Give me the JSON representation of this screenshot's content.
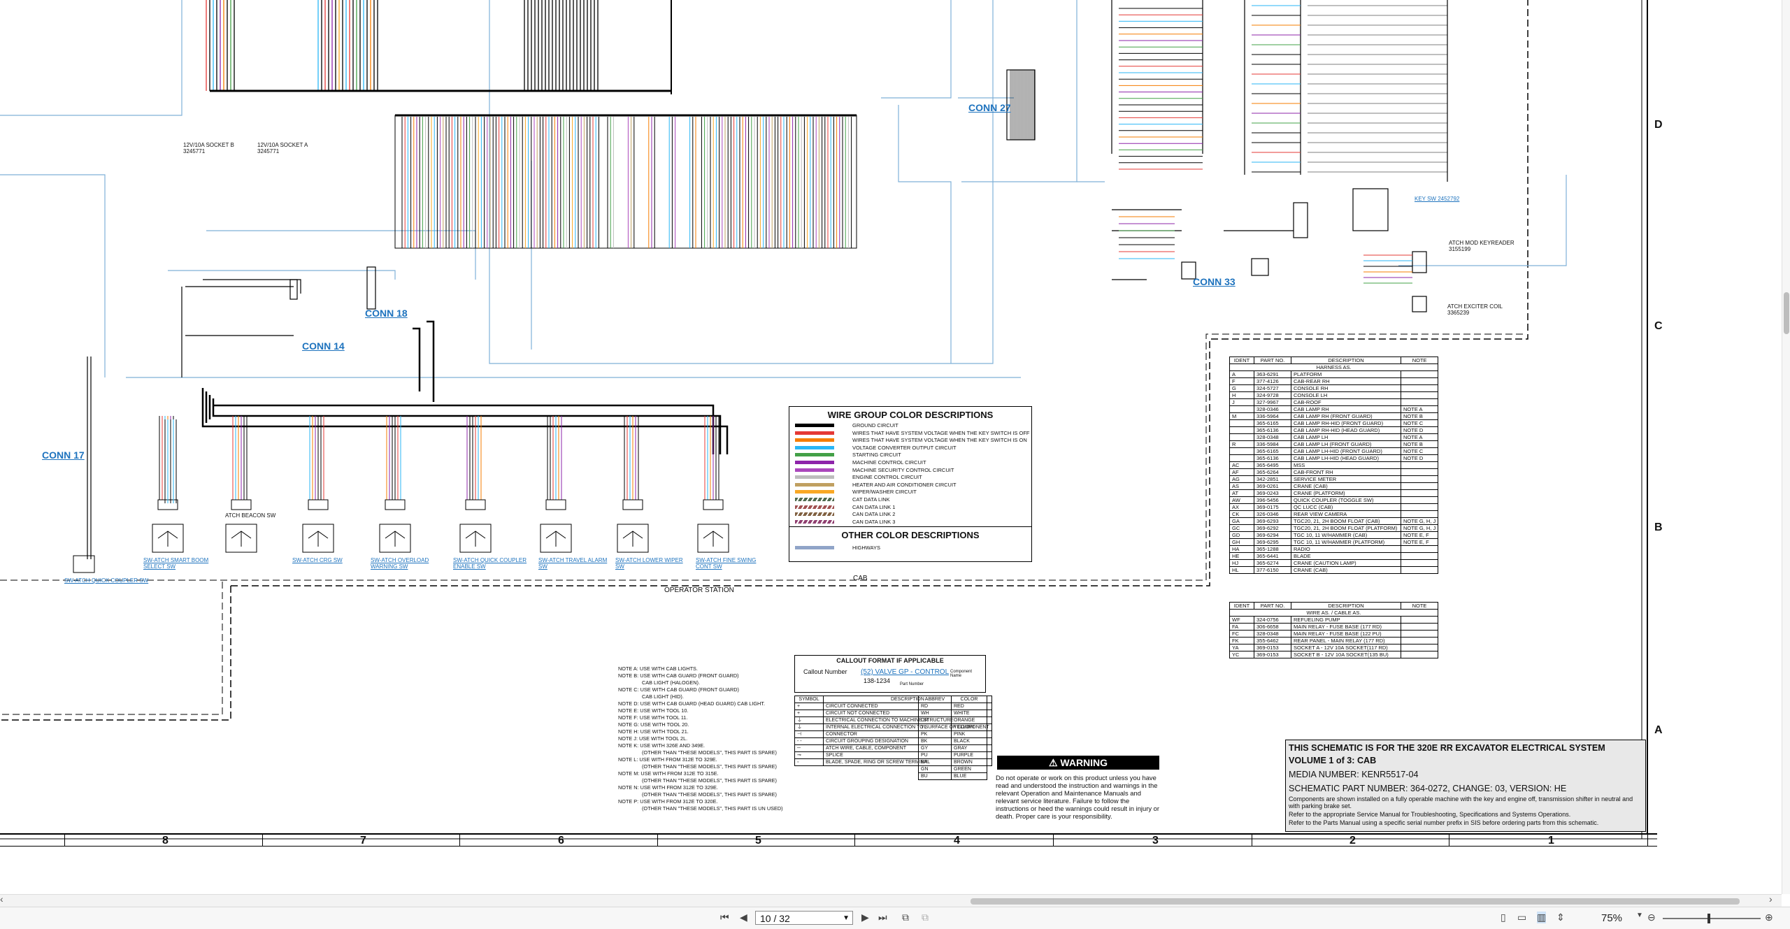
{
  "schematic": {
    "connectors": {
      "conn27": "CONN 27",
      "conn18": "CONN 18",
      "conn14": "CONN 14",
      "conn17": "CONN 17",
      "conn33": "CONN 33"
    },
    "labels": {
      "cab": "CAB",
      "operator_station": "OPERATOR STATION",
      "socket_b": "12V/10A SOCKET B\n3245771",
      "socket_a": "12V/10A SOCKET A\n3245771",
      "atch_beacon": "ATCH BEACON SW",
      "quick_coupler": "SW-ATCH QUICK COUPLER SW",
      "atch_mod": "ATCH MOD KEYREADER\n3155199",
      "atch_exciter": "ATCH EXCITER COIL\n3365239",
      "key_sw": "KEY SW\n2452792"
    },
    "switches": [
      "SW-ATCH SMART BOOM SELECT SW",
      "SW-ATCH CRG SW",
      "SW-ATCH OVERLOAD WARNING SW",
      "SW-ATCH QUICK COUPLER ENABLE SW",
      "SW-ATCH TRAVEL ALARM SW",
      "SW-ATCH LOWER WIPER SW",
      "SW-ATCH FINE SWING CONT SW"
    ]
  },
  "wire_colors": {
    "title": "WIRE GROUP COLOR DESCRIPTIONS",
    "items": [
      {
        "color": "#000000",
        "desc": "GROUND CIRCUIT"
      },
      {
        "color": "#e53935",
        "desc": "WIRES THAT HAVE SYSTEM VOLTAGE WHEN THE KEY SWITCH IS OFF"
      },
      {
        "color": "#f57c00",
        "desc": "WIRES THAT HAVE SYSTEM VOLTAGE WHEN THE KEY SWITCH IS ON"
      },
      {
        "color": "#29b6f6",
        "desc": "VOLTAGE CONVERTER OUTPUT CIRCUIT"
      },
      {
        "color": "#43a047",
        "desc": "STARTING CIRCUIT"
      },
      {
        "color": "#8e24aa",
        "desc": "MACHINE CONTROL CIRCUIT"
      },
      {
        "color": "#ab47bc",
        "desc": "MACHINE SECURITY CONTROL CIRCUIT"
      },
      {
        "color": "#bdbdbd",
        "desc": "ENGINE CONTROL CIRCUIT"
      },
      {
        "color": "#c0a060",
        "desc": "HEATER AND AIR CONDITIONER CIRCUIT"
      },
      {
        "color": "#f9a825",
        "desc": "WIPER/WASHER CIRCUIT"
      },
      {
        "color": "#4e6a4e",
        "desc": "CAT DATA LINK"
      },
      {
        "color": "#a05050",
        "desc": "CAN DATA LINK 1"
      },
      {
        "color": "#806040",
        "desc": "CAN DATA LINK 2"
      },
      {
        "color": "#904070",
        "desc": "CAN DATA LINK 3"
      }
    ],
    "other_title": "OTHER COLOR DESCRIPTIONS",
    "other_items": [
      {
        "color": "#90a4c8",
        "desc": "HIGHWAYS"
      }
    ]
  },
  "callout": {
    "title": "CALLOUT FORMAT IF APPLICABLE",
    "callout_number": "Callout Number",
    "sample": "(52) VALVE GP - CONTROL",
    "part": "138-1234",
    "component_name": "Component Name",
    "part_number": "Part Number"
  },
  "symbols": {
    "headers": [
      "SYMBOL",
      "DESCRIPTION"
    ],
    "rows": [
      {
        "sym": "+",
        "desc": "CIRCUIT CONNECTED"
      },
      {
        "sym": "+",
        "desc": "CIRCUIT NOT CONNECTED"
      },
      {
        "sym": "⏚",
        "desc": "ELECTRICAL CONNECTION TO MACHINE STRUCTURE"
      },
      {
        "sym": "⏚",
        "desc": "INTERNAL ELECTRICAL CONNECTION TO SURFACE OF COMPONENT"
      },
      {
        "sym": "⊣",
        "desc": "CONNECTOR"
      },
      {
        "sym": "- -",
        "desc": "CIRCUIT GROUPING DESIGNATION"
      },
      {
        "sym": "─",
        "desc": "ATCH WIRE, CABLE, COMPONENT"
      },
      {
        "sym": "⊸",
        "desc": "SPLICE"
      },
      {
        "sym": "◦",
        "desc": "BLADE, SPADE, RING OR SCREW TERMINAL"
      }
    ]
  },
  "abbrev": {
    "headers": [
      "ABBREV",
      "COLOR"
    ],
    "rows": [
      [
        "RD",
        "RED"
      ],
      [
        "WH",
        "WHITE"
      ],
      [
        "OR",
        "ORANGE"
      ],
      [
        "YL",
        "YELLOW"
      ],
      [
        "PK",
        "PINK"
      ],
      [
        "BK",
        "BLACK"
      ],
      [
        "GY",
        "GRAY"
      ],
      [
        "PU",
        "PURPLE"
      ],
      [
        "BR",
        "BROWN"
      ],
      [
        "GN",
        "GREEN"
      ],
      [
        "BU",
        "BLUE"
      ]
    ]
  },
  "notes": [
    "NOTE A: USE WITH CAB LIGHTS.",
    "NOTE B: USE WITH CAB GUARD (FRONT GUARD)",
    "CAB LIGHT (HALOGEN).",
    "NOTE C: USE WITH CAB GUARD (FRONT GUARD)",
    "CAB LIGHT (HID).",
    "NOTE D: USE WITH CAB GUARD (HEAD GUARD) CAB LIGHT.",
    "NOTE E: USE WITH TOOL 10.",
    "NOTE F: USE WITH TOOL 11.",
    "NOTE G: USE WITH TOOL 20.",
    "NOTE H: USE WITH TOOL 21.",
    "NOTE J: USE WITH TOOL 2L.",
    "NOTE K: USE WITH 326E AND 349E.",
    "(OTHER THAN \"THESE MODELS\", THIS PART IS SPARE)",
    "NOTE L: USE WITH FROM 312E TO 329E.",
    "(OTHER THAN \"THESE MODELS\", THIS PART IS SPARE)",
    "NOTE M: USE WITH FROM 312E TO 315E.",
    "(OTHER THAN \"THESE MODELS\", THIS PART IS SPARE)",
    "NOTE N: USE WITH FROM 312E TO 329E.",
    "(OTHER THAN \"THESE MODELS\", THIS PART IS SPARE)",
    "NOTE P: USE WITH FROM 312E TO 320E.",
    "(OTHER THAN \"THESE MODELS\", THIS PART IS UN USED)"
  ],
  "warning": {
    "title": "WARNING",
    "text": "Do not operate or work on this product unless you have read and understood the instruction and warnings in the relevant Operation and Maintenance Manuals and relevant service literature. Failure to follow the instructions or heed the warnings could result in injury or death. Proper care is your responsibility."
  },
  "title_block": {
    "line1": "THIS SCHEMATIC IS FOR THE 320E RR EXCAVATOR ELECTRICAL SYSTEM",
    "line2": "VOLUME 1 of 3: CAB",
    "line3": "MEDIA NUMBER: KENR5517-04",
    "line4": "SCHEMATIC PART NUMBER: 364-0272, CHANGE: 03, VERSION: HE",
    "line5": "Components are shown installed on a fully operable machine with the key and engine off, transmission shifter in neutral and with parking brake set.",
    "line6": "Refer to the appropriate Service Manual for Troubleshooting, Specifications and Systems Operations.",
    "line7": "Refer to the Parts Manual using a specific serial number prefix in SIS before ordering parts from this schematic."
  },
  "harness_table": {
    "headers": [
      "IDENT",
      "PART NO.",
      "DESCRIPTION",
      "NOTE"
    ],
    "section": "HARNESS AS.",
    "rows": [
      [
        "A",
        "363-6291",
        "PLATFORM",
        ""
      ],
      [
        "F",
        "377-4126",
        "CAB-REAR RH",
        ""
      ],
      [
        "G",
        "324-5727",
        "CONSOLE RH",
        ""
      ],
      [
        "H",
        "324-9728",
        "CONSOLE LH",
        ""
      ],
      [
        "J",
        "327-9967",
        "CAB-ROOF",
        ""
      ],
      [
        "",
        "328-0346",
        "CAB LAMP RH",
        "NOTE A"
      ],
      [
        "M",
        "336-5964",
        "CAB LAMP RH (FRONT GUARD)",
        "NOTE B"
      ],
      [
        "",
        "365-6165",
        "CAB LAMP RH-HID (FRONT GUARD)",
        "NOTE C"
      ],
      [
        "",
        "365-6136",
        "CAB LAMP RH-HID (HEAD GUARD)",
        "NOTE D"
      ],
      [
        "",
        "328-0348",
        "CAB LAMP LH",
        "NOTE A"
      ],
      [
        "R",
        "336-5984",
        "CAB LAMP LH (FRONT GUARD)",
        "NOTE B"
      ],
      [
        "",
        "365-6165",
        "CAB LAMP LH-HID (FRONT GUARD)",
        "NOTE C"
      ],
      [
        "",
        "365-6136",
        "CAB LAMP LH-HID (HEAD GUARD)",
        "NOTE D"
      ],
      [
        "AC",
        "365-6495",
        "MSS",
        ""
      ],
      [
        "AF",
        "365-6264",
        "CAB-FRONT RH",
        ""
      ],
      [
        "AG",
        "342-2851",
        "SERVICE METER",
        ""
      ],
      [
        "AS",
        "369-0261",
        "CRANE (CAB)",
        ""
      ],
      [
        "AT",
        "369-0243",
        "CRANE (PLATFORM)",
        ""
      ],
      [
        "AW",
        "396-5456",
        "QUICK COUPLER (TOGGLE SW)",
        ""
      ],
      [
        "AX",
        "369-0175",
        "QC LUCC (CAB)",
        ""
      ],
      [
        "CK",
        "326-0346",
        "REAR VIEW CAMERA",
        ""
      ],
      [
        "GA",
        "369-6293",
        "TGC20, 21, 2H BOOM FLOAT (CAB)",
        "NOTE G, H, J"
      ],
      [
        "GC",
        "369-6292",
        "TGC20, 21, 2H BOOM FLOAT (PLATFORM)",
        "NOTE G, H, J"
      ],
      [
        "GD",
        "369-6294",
        "TGC 10, 11 W/HAMMER (CAB)",
        "NOTE E, F"
      ],
      [
        "GH",
        "369-6295",
        "TGC 10, 11 W/HAMMER (PLATFORM)",
        "NOTE E, F"
      ],
      [
        "HA",
        "365-1288",
        "RADIO",
        ""
      ],
      [
        "HE",
        "365-6441",
        "BLADE",
        ""
      ],
      [
        "HJ",
        "365-6274",
        "CRANE (CAUTION LAMP)",
        ""
      ],
      [
        "HL",
        "377-6150",
        "CRANE (CAB)",
        ""
      ]
    ],
    "section2": "WIRE AS. / CABLE AS.",
    "rows2": [
      [
        "WF",
        "324-0756",
        "REFUELING PUMP",
        ""
      ],
      [
        "FA",
        "306-6658",
        "MAIN RELAY - FUSE BASE (177 RD)",
        ""
      ],
      [
        "FC",
        "328-0348",
        "MAIN RELAY - FUSE BASE (122 PU)",
        ""
      ],
      [
        "FK",
        "355-6462",
        "REAR PANEL - MAIN RELAY (177 RD)",
        ""
      ],
      [
        "YA",
        "369-0153",
        "SOCKET A - 12V 10A SOCKET(117 RD)",
        ""
      ],
      [
        "YC",
        "369-0153",
        "SOCKET B - 12V 10A SOCKET(135 BU)",
        ""
      ]
    ]
  },
  "grid": {
    "cols": [
      "8",
      "7",
      "6",
      "5",
      "4",
      "3",
      "2",
      "1"
    ],
    "rows": [
      "D",
      "C",
      "B",
      "A"
    ]
  },
  "viewer": {
    "page": "10 / 32",
    "zoom": "75%"
  }
}
